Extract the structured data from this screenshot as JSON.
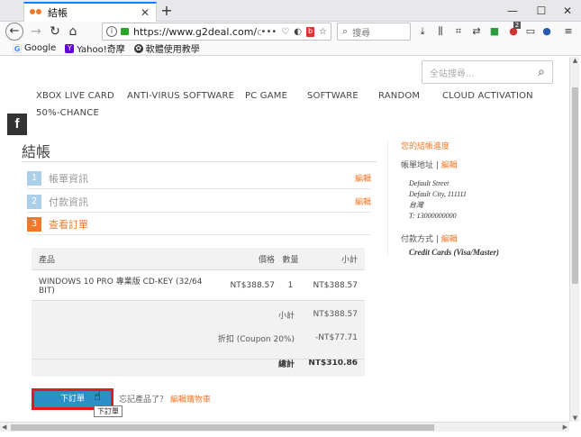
{
  "browser": {
    "tab_title": "結帳",
    "url_main": "https://www.g2deal.com/",
    "url_dim": "ch",
    "search_placeholder": "搜尋",
    "url_more": "•••",
    "url_badge": "b",
    "ext_badge_count": "2"
  },
  "bookmarks": [
    {
      "label": "Google",
      "icon": "google-icon"
    },
    {
      "label": "Yahoo!奇摩",
      "icon": "yahoo-icon"
    },
    {
      "label": "軟體使用教學",
      "icon": "bookmark-icon"
    }
  ],
  "site": {
    "search_placeholder": "全站搜尋...",
    "menu": [
      "XBOX LIVE CARD",
      "ANTI-VIRUS SOFTWARE",
      "PC GAME",
      "SOFTWARE",
      "RANDOM",
      "CLOUD ACTIVATION",
      "50%-CHANCE"
    ],
    "social": "f"
  },
  "checkout": {
    "title": "結帳",
    "steps": [
      {
        "num": "1",
        "label": "帳單資訊",
        "edit": "編輯"
      },
      {
        "num": "2",
        "label": "付款資訊",
        "edit": "編輯"
      },
      {
        "num": "3",
        "label": "查看訂單",
        "edit": ""
      }
    ],
    "table": {
      "headers": {
        "product": "產品",
        "price": "價格",
        "qty": "數量",
        "subtotal": "小計"
      },
      "row": {
        "product": "WINDOWS 10 PRO 專業版 CD-KEY (32/64 BIT)",
        "price": "NT$388.57",
        "qty": "1",
        "subtotal": "NT$388.57"
      },
      "summary": [
        {
          "label": "小計",
          "value": "NT$388.57"
        },
        {
          "label": "折扣 (Coupon 20%)",
          "value": "-NT$77.71"
        },
        {
          "label": "總計",
          "value": "NT$310.86"
        }
      ]
    },
    "place_order": "下訂單",
    "tooltip": "下訂單",
    "forgot_text": "忘記產品了？",
    "forgot_link": "編輯購物車"
  },
  "progress": {
    "title": "您的結帳進度",
    "billing_label": "帳單地址",
    "billing_edit": "編輯",
    "address": [
      "Default Street",
      "Default City, 111111",
      "台灣",
      "T: 13000000000"
    ],
    "payment_label": "付款方式",
    "payment_edit": "編輯",
    "payment_value": "Credit Cards (Visa/Master)"
  },
  "colors": {
    "accent": "#f07a2b",
    "button": "#2d8fc7",
    "highlight": "#e01d1d"
  }
}
